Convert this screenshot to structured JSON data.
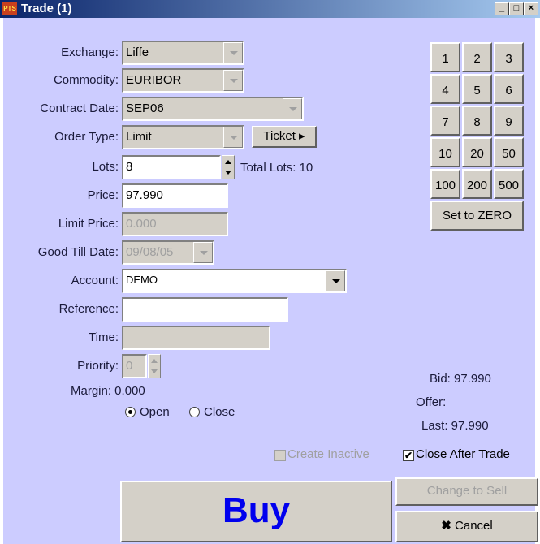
{
  "window": {
    "title": "Trade (1)",
    "app_icon_text": "PTS"
  },
  "form": {
    "exchange_label": "Exchange:",
    "exchange_value": "Liffe",
    "commodity_label": "Commodity:",
    "commodity_value": "EURIBOR",
    "contract_label": "Contract Date:",
    "contract_value": "SEP06",
    "order_type_label": "Order Type:",
    "order_type_value": "Limit",
    "ticket_label": "Ticket ▸",
    "lots_label": "Lots:",
    "lots_value": "8",
    "total_lots_text": "Total Lots: 10",
    "price_label": "Price:",
    "price_value": "97.990",
    "limit_price_label": "Limit Price:",
    "limit_price_value": "0.000",
    "good_till_label": "Good Till Date:",
    "good_till_value": "09/08/05",
    "account_label": "Account:",
    "account_value": "DEMO",
    "reference_label": "Reference:",
    "reference_value": "",
    "time_label": "Time:",
    "time_value": "",
    "priority_label": "Priority:",
    "priority_value": "0",
    "margin_text": "Margin: 0.000",
    "open_label": "Open",
    "close_label": "Close",
    "open_selected": true
  },
  "numpad": {
    "keys": [
      "1",
      "2",
      "3",
      "4",
      "5",
      "6",
      "7",
      "8",
      "9",
      "10",
      "20",
      "50",
      "100",
      "200",
      "500"
    ],
    "zero_label": "Set to ZERO"
  },
  "quote": {
    "bid_text": "Bid: 97.990",
    "offer_text": "Offer:",
    "last_text": "Last: 97.990"
  },
  "options": {
    "create_inactive_label": "Create Inactive",
    "create_inactive_checked": false,
    "close_after_label": "Close After Trade",
    "close_after_checked": true
  },
  "actions": {
    "buy_label": "Buy",
    "change_sell_label": "Change to Sell",
    "cancel_label": "Cancel",
    "buy_color": "#0000ee"
  }
}
